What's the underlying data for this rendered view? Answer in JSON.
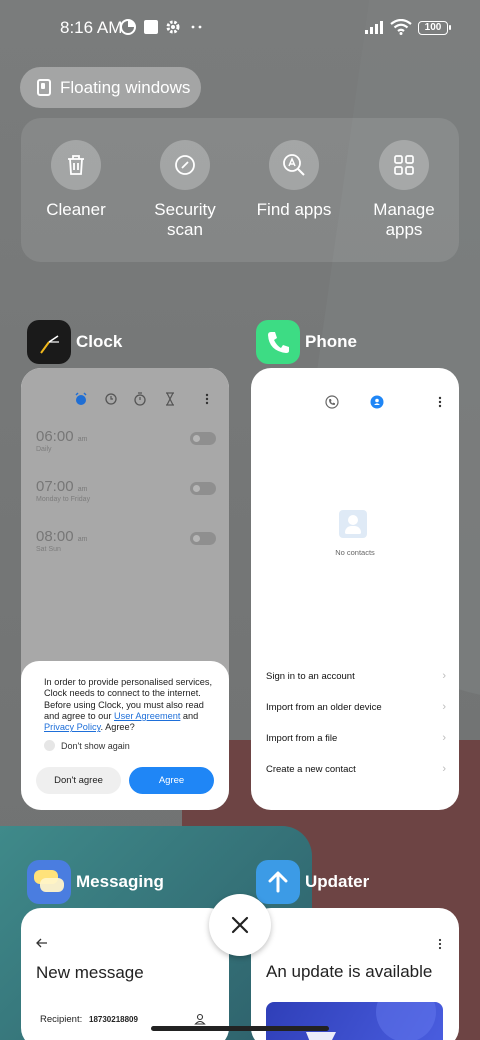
{
  "status_bar": {
    "time": "8:16 AM",
    "battery": "100",
    "icons": [
      "data-saver-icon",
      "notification-square-icon",
      "settings-gear-icon",
      "more-dots-icon",
      "signal-icon",
      "wifi-icon",
      "battery-icon"
    ]
  },
  "floating_windows": {
    "label": "Floating windows"
  },
  "quick_actions": [
    {
      "label": "Cleaner",
      "icon": "trash-icon"
    },
    {
      "label": "Security\nscan",
      "icon": "security-scan-icon"
    },
    {
      "label": "Find apps",
      "icon": "find-apps-icon"
    },
    {
      "label": "Manage\napps",
      "icon": "grid-icon"
    }
  ],
  "apps": {
    "clock": {
      "name": "Clock",
      "alarms": [
        {
          "time": "06:00",
          "ampm": "am",
          "sub": "Daily"
        },
        {
          "time": "07:00",
          "ampm": "am",
          "sub": "Monday to Friday"
        },
        {
          "time": "08:00",
          "ampm": "am",
          "sub": "Sat Sun"
        }
      ],
      "consent": {
        "text_1": "In order to provide personalised services, Clock needs to connect to the internet. Before using Clock, you must also read and agree to our ",
        "link_1": "User Agreement",
        "text_2": " and ",
        "link_2": "Privacy Policy",
        "text_3": ". Agree?",
        "dont_show": "Don't show again",
        "disagree": "Don't agree",
        "agree": "Agree"
      }
    },
    "phone": {
      "name": "Phone",
      "empty": "No contacts",
      "items": [
        "Sign in to an account",
        "Import from an older device",
        "Import from a file",
        "Create a new contact"
      ]
    },
    "messaging": {
      "name": "Messaging",
      "title": "New message",
      "recipient_label": "Recipient:",
      "recipient_value": "18730218809"
    },
    "updater": {
      "name": "Updater",
      "title": "An update is available"
    }
  },
  "colors": {
    "accent": "#1f86f6",
    "phone_icon": "#3ddc84",
    "updater_icon": "#3c9be6",
    "messaging_icon": "#4a7de0"
  }
}
